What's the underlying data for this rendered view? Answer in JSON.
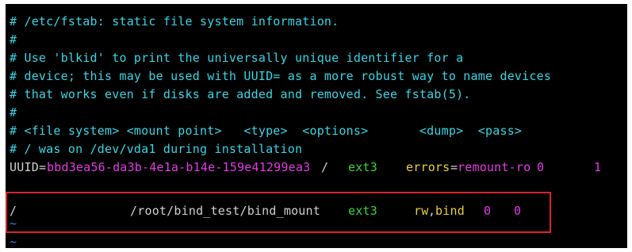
{
  "comments": [
    "# /etc/fstab: static file system information.",
    "#",
    "# Use 'blkid' to print the universally unique identifier for a",
    "# device; this may be used with UUID= as a more robust way to name devices",
    "# that works even if disks are added and removed. See fstab(5).",
    "#",
    "# <file system> <mount point>   <type>  <options>       <dump>  <pass>",
    "# / was on /dev/vda1 during installation"
  ],
  "uuid_entry": {
    "key": "UUID",
    "eq": "=",
    "value": "bbd3ea56-da3b-4e1a-b14e-159e41299ea3",
    "mount_point": "/",
    "type": "ext3",
    "options_key": "errors",
    "options_eq": "=",
    "options_value": "remount-ro",
    "dump": "0",
    "pass": "1"
  },
  "bind_entry": {
    "file_system": "/",
    "mount_point": "/root/bind_test/bind_mount",
    "type": "ext3",
    "options_a": "rw",
    "options_sep": ",",
    "options_b": "bind",
    "dump": "0",
    "pass": "0"
  },
  "tilde": "~",
  "colors": {
    "comment": "#36d6e6",
    "text": "#cfcfcf",
    "value": "#e43ae4",
    "type": "#35d835",
    "keyword": "#e6d23a",
    "tilde": "#3a7cf0",
    "highlight_border": "#d9242a"
  }
}
